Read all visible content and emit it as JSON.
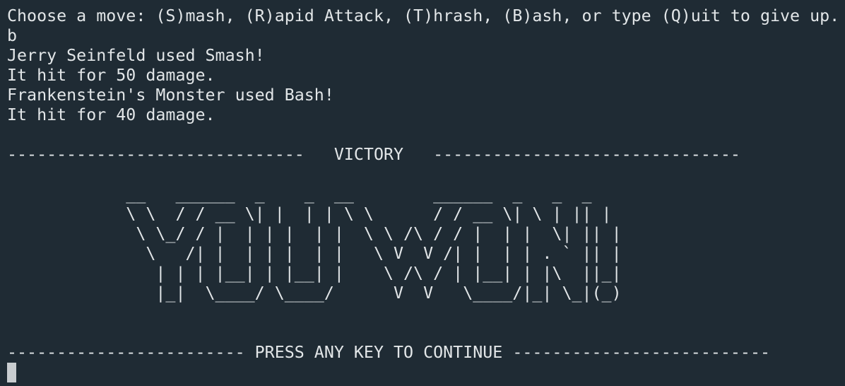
{
  "terminal": {
    "prompt": "Choose a move: (S)mash, (R)apid Attack, (T)hrash, (B)ash, or type (Q)uit to give up.",
    "user_input": "b",
    "log": [
      "Jerry Seinfeld used Smash!",
      "It hit for 50 damage.",
      "Frankenstein's Monster used Bash!",
      "It hit for 40 damage."
    ],
    "victory_banner": "------------------------------   VICTORY   -------------------------------",
    "ascii_art": "            __   ______  _    _  __        ______  _   _  _ \n            \\ \\  / / __ \\| |  | | \\ \\      / / __ \\| \\ | || |\n             \\ \\_/ / |  | | |  | |  \\ \\ /\\ / / |  | |  \\| || |\n              \\   /| |  | | |  | |   \\ V  V /| |  | | . ` || |\n               | | | |__| | |__| |    \\ /\\ / | |__| | |\\  ||_|\n               |_|  \\____/ \\____/      V  V   \\____/|_| \\_|(_)",
    "continue_banner": "------------------------ PRESS ANY KEY TO CONTINUE --------------------------"
  },
  "colors": {
    "background": "#1f2b34",
    "foreground": "#e2e6e8",
    "cursor": "#c9cdd0"
  }
}
